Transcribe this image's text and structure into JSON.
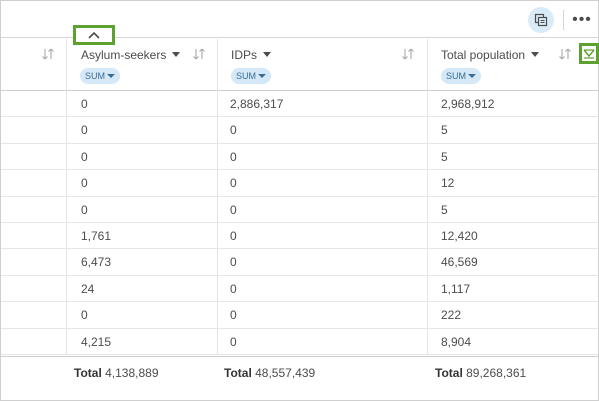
{
  "toolbar": {
    "more_label": "•••"
  },
  "columns": [
    {
      "label": "Asylum-seekers",
      "agg": "SUM"
    },
    {
      "label": "IDPs",
      "agg": "SUM"
    },
    {
      "label": "Total population",
      "agg": "SUM"
    }
  ],
  "rows": [
    [
      "0",
      "2,886,317",
      "2,968,912"
    ],
    [
      "0",
      "0",
      "5"
    ],
    [
      "0",
      "0",
      "5"
    ],
    [
      "0",
      "0",
      "12"
    ],
    [
      "0",
      "0",
      "5"
    ],
    [
      "1,761",
      "0",
      "12,420"
    ],
    [
      "6,473",
      "0",
      "46,569"
    ],
    [
      "24",
      "0",
      "1,117"
    ],
    [
      "0",
      "0",
      "222"
    ],
    [
      "4,215",
      "0",
      "8,904"
    ]
  ],
  "totals": {
    "label": "Total",
    "values": [
      "4,138,889",
      "48,557,439",
      "89,268,361"
    ]
  },
  "colors": {
    "highlight": "#5da130",
    "badge_bg": "#d4e8f7",
    "badge_text": "#3b6d94"
  },
  "icons": {
    "collapse": "chevron-up-icon",
    "copy": "copy-icon",
    "sort": "sort-icon",
    "check": "checkmark-icon"
  }
}
